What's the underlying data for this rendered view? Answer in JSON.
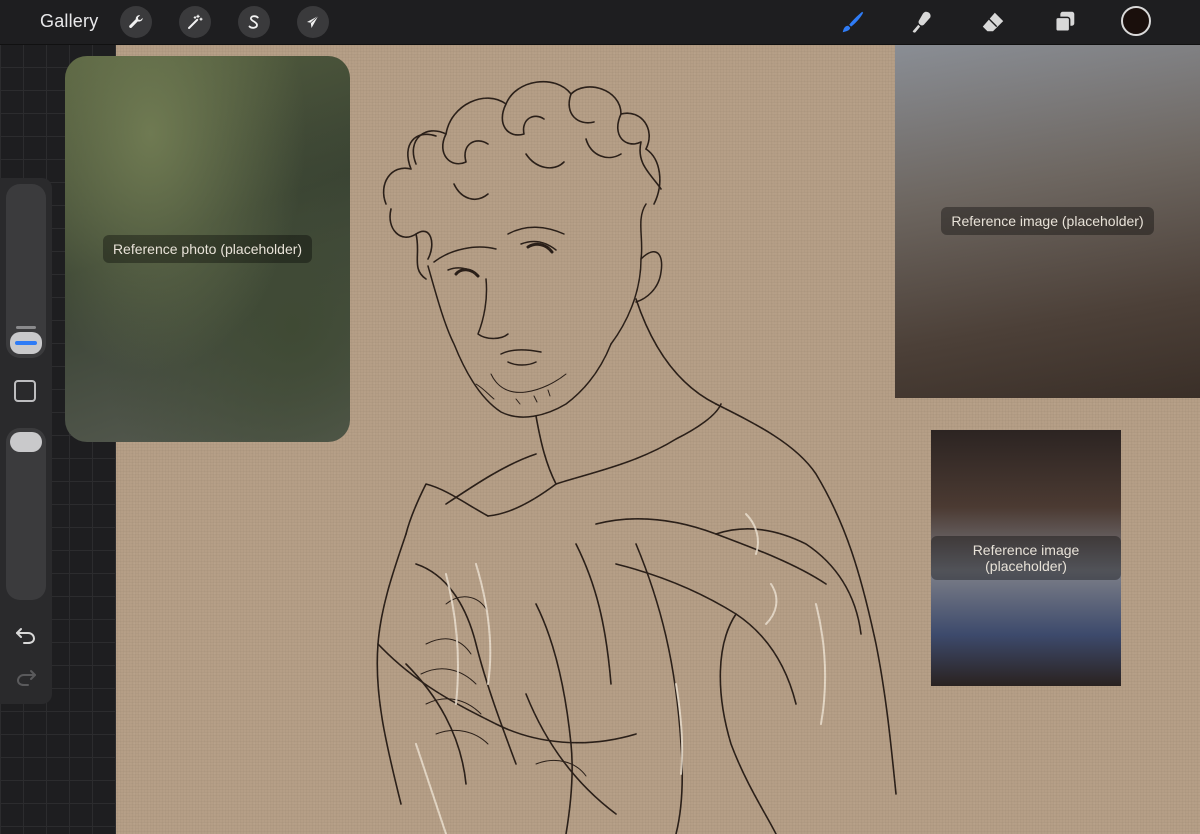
{
  "topbar": {
    "gallery_label": "Gallery",
    "tools_left": [
      {
        "name": "actions",
        "icon": "wrench-icon"
      },
      {
        "name": "adjustments",
        "icon": "magic-wand-icon"
      },
      {
        "name": "selection",
        "icon": "selection-s-icon"
      },
      {
        "name": "transform",
        "icon": "arrow-cursor-icon"
      }
    ],
    "tools_right": [
      {
        "name": "brush",
        "icon": "brush-icon",
        "active": true
      },
      {
        "name": "smudge",
        "icon": "smudge-icon",
        "active": false
      },
      {
        "name": "eraser",
        "icon": "eraser-icon",
        "active": false
      },
      {
        "name": "layers",
        "icon": "layers-icon",
        "active": false
      }
    ],
    "current_color": "#1a0f0c",
    "accent_color": "#2f7cf6"
  },
  "sidebar": {
    "undo_icon": "undo-icon",
    "redo_icon": "redo-icon",
    "modify_icon": "square-icon"
  },
  "canvas": {
    "background_color": "#b59e86",
    "stroke_color": "#2a1f18",
    "highlight_color": "#ece0d0"
  },
  "references": {
    "photo_placeholder": "Reference photo (placeholder)",
    "game_placeholder_1": "Reference image (placeholder)",
    "game_placeholder_2": "Reference image (placeholder)"
  }
}
